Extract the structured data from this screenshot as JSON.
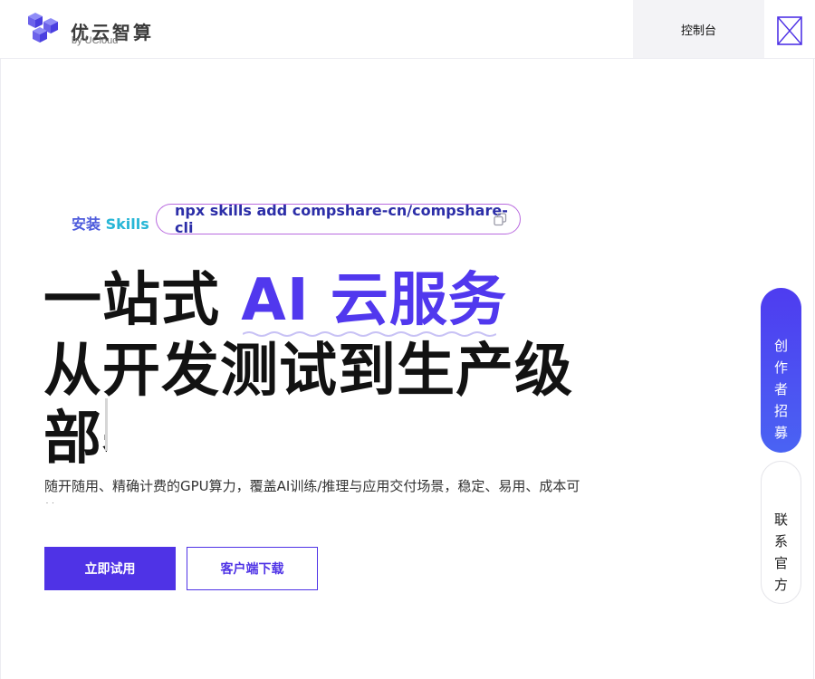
{
  "header": {
    "logo_title": "优云智算",
    "logo_sub": "by UCloud",
    "console_label": "控制台"
  },
  "install": {
    "label_prefix": "安装",
    "label_skills": "Skills",
    "command": "npx skills add compshare-cn/compshare-cli"
  },
  "hero": {
    "line1_prefix": "一站式",
    "line1_accent": "AI 云服务",
    "line2": "从开发测试到生产级",
    "line3": "部署"
  },
  "description": "随开随用、精确计费的GPU算力，覆盖AI训练/推理与应用交付场景，稳定、易用、成本可控",
  "buttons": {
    "primary": "立即试用",
    "secondary": "客户端下载"
  },
  "float": {
    "recruit": "创作者招募",
    "contact": "联系官方"
  },
  "colors": {
    "accent": "#5138ee",
    "primary_button": "#4f33e6",
    "pill_border": "#b96adf"
  }
}
